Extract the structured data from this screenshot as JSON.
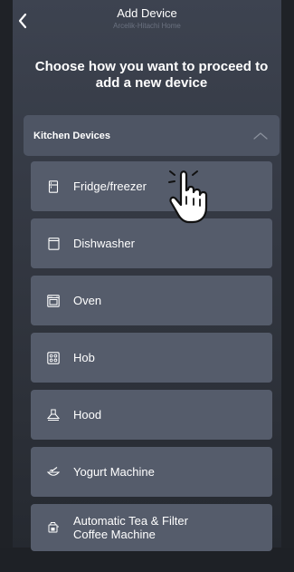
{
  "header": {
    "title": "Add Device",
    "subtitle": "Arcelik-Hitachi Home",
    "back_icon": "chevron-left-icon"
  },
  "heading": "Choose how you want to proceed to add a new device",
  "category": {
    "label": "Kitchen Devices",
    "expanded": true,
    "toggle_icon": "chevron-up-icon"
  },
  "devices": [
    {
      "label": "Fridge/freezer",
      "icon": "fridge-icon"
    },
    {
      "label": "Dishwasher",
      "icon": "dishwasher-icon"
    },
    {
      "label": "Oven",
      "icon": "oven-icon"
    },
    {
      "label": "Hob",
      "icon": "hob-icon"
    },
    {
      "label": "Hood",
      "icon": "hood-icon"
    },
    {
      "label": "Yogurt Machine",
      "icon": "yogurt-machine-icon"
    },
    {
      "label_line1": "Automatic Tea & Filter",
      "label_line2": "Coffee Machine",
      "icon": "tea-coffee-machine-icon"
    }
  ],
  "colors": {
    "background": "#1b1e24",
    "panel": "#3d4350",
    "category_bg": "#4e5564",
    "device_bg": "#555c6b",
    "text": "#ffffff",
    "subtitle": "#6b7280"
  }
}
